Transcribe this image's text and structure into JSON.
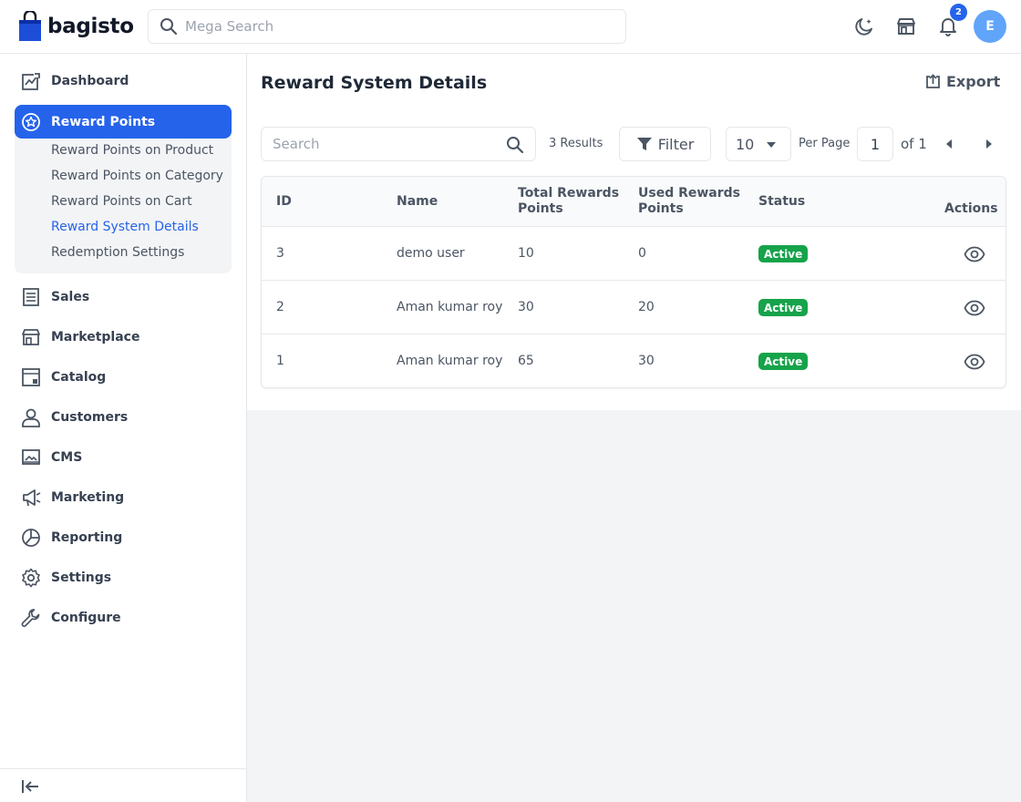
{
  "header": {
    "logo_text": "bagisto",
    "search_placeholder": "Mega Search",
    "notification_count": "2",
    "avatar_initial": "E",
    "icons": [
      "moon-icon",
      "store-icon",
      "bell-icon"
    ]
  },
  "sidebar": {
    "items": [
      {
        "label": "Dashboard",
        "icon": "dashboard-icon"
      },
      {
        "label": "Reward Points",
        "icon": "star-icon",
        "active": true
      },
      {
        "label": "Sales",
        "icon": "sales-icon"
      },
      {
        "label": "Marketplace",
        "icon": "store-icon"
      },
      {
        "label": "Catalog",
        "icon": "catalog-icon"
      },
      {
        "label": "Customers",
        "icon": "user-icon"
      },
      {
        "label": "CMS",
        "icon": "cms-icon"
      },
      {
        "label": "Marketing",
        "icon": "megaphone-icon"
      },
      {
        "label": "Reporting",
        "icon": "pie-icon"
      },
      {
        "label": "Settings",
        "icon": "gear-icon"
      },
      {
        "label": "Configure",
        "icon": "wrench-icon"
      }
    ],
    "submenu": [
      {
        "label": "Reward Points on Product"
      },
      {
        "label": "Reward Points on Category"
      },
      {
        "label": "Reward Points on Cart"
      },
      {
        "label": "Reward System Details",
        "current": true
      },
      {
        "label": "Redemption Settings"
      }
    ]
  },
  "main": {
    "title": "Reward System Details",
    "export_label": "Export",
    "search_placeholder": "Search",
    "results_text": "3 Results",
    "filter_label": "Filter",
    "per_page_value": "10",
    "per_page_label": "Per Page",
    "current_page": "1",
    "page_of": "of 1",
    "table": {
      "headers": {
        "id": "ID",
        "name": "Name",
        "total_1": "Total Rewards",
        "total_2": "Points",
        "used_1": "Used Rewards",
        "used_2": "Points",
        "status": "Status",
        "actions": "Actions"
      },
      "rows": [
        {
          "id": "3",
          "name": "demo user",
          "total": "10",
          "used": "0",
          "status": "Active"
        },
        {
          "id": "2",
          "name": "Aman kumar roy",
          "total": "30",
          "used": "20",
          "status": "Active"
        },
        {
          "id": "1",
          "name": "Aman kumar roy",
          "total": "65",
          "used": "30",
          "status": "Active"
        }
      ]
    }
  },
  "colors": {
    "accent": "#2563eb",
    "status_active": "#16a34a",
    "avatar": "#60a5fa"
  }
}
